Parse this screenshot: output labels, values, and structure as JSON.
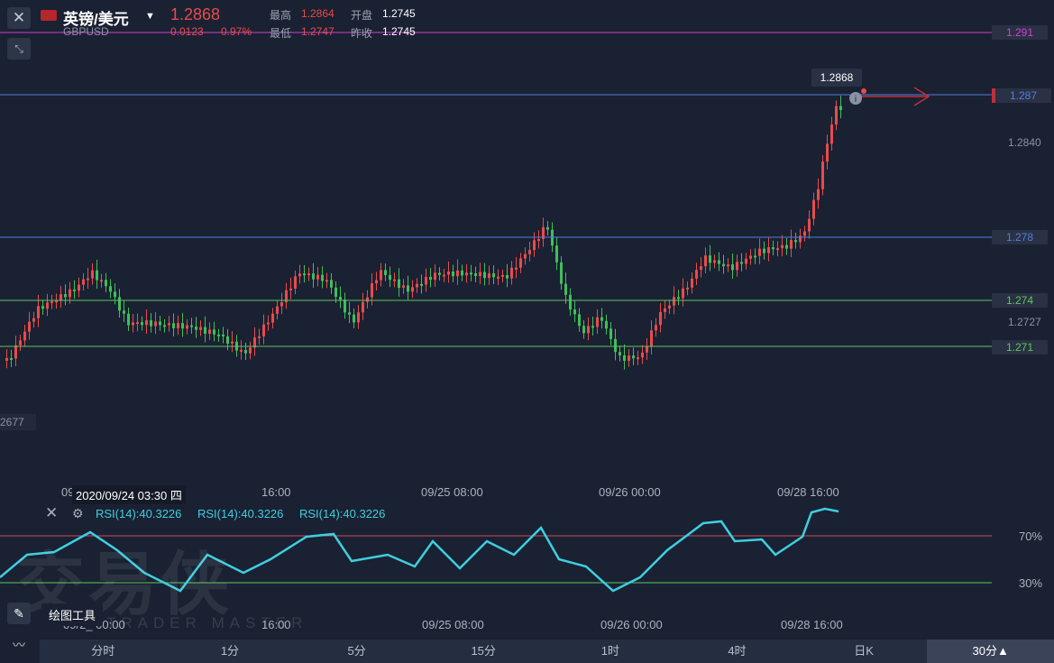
{
  "header": {
    "symbol_name": "英镑/美元",
    "symbol_code": "GBPUSD",
    "price": "1.2868",
    "change": "0.0123",
    "change_pct": "0.97%",
    "high_label": "最高",
    "high_value": "1.2864",
    "open_label": "开盘",
    "open_value": "1.2745",
    "low_label": "最低",
    "low_value": "1.2747",
    "prev_close_label": "昨收",
    "prev_close_value": "1.2745"
  },
  "price_levels": {
    "l1291": "1.291",
    "l1287": "1.287",
    "l1284": "1.2840",
    "l1278": "1.278",
    "l1274": "1.274",
    "l12727": "1.2727",
    "l1271": "1.271",
    "left_tag": "2677",
    "last_tag": "1.2868"
  },
  "x_axis": {
    "t0": "09",
    "t1": "16:00",
    "t2": "09/25 08:00",
    "t3": "09/26 00:00",
    "t4": "09/28 16:00"
  },
  "crosshair_date": "2020/09/24 03:30 四",
  "rsi": {
    "label1": "RSI(14):40.3226",
    "label2": "RSI(14):40.3226",
    "label3": "RSI(14):40.3226",
    "level70": "70%",
    "level30": "30%",
    "x0": "09/2_  00:00",
    "x1": "16:00",
    "x2": "09/25 08:00",
    "x3": "09/26 00:00",
    "x4": "09/28 16:00"
  },
  "tools": {
    "draw_label": "绘图工具"
  },
  "watermark": {
    "main": "交易侠",
    "sub": "TRADER MASTER"
  },
  "tabs": [
    "分时",
    "1分",
    "5分",
    "15分",
    "1时",
    "4时",
    "日K",
    "30分▲"
  ],
  "colors": {
    "up": "#e94b4b",
    "down": "#3fbf5a",
    "blue_line": "#4f7fe0",
    "magenta_line": "#d33fd3",
    "green_line": "#5cc85c",
    "rsi": "#3ecfe0"
  }
}
